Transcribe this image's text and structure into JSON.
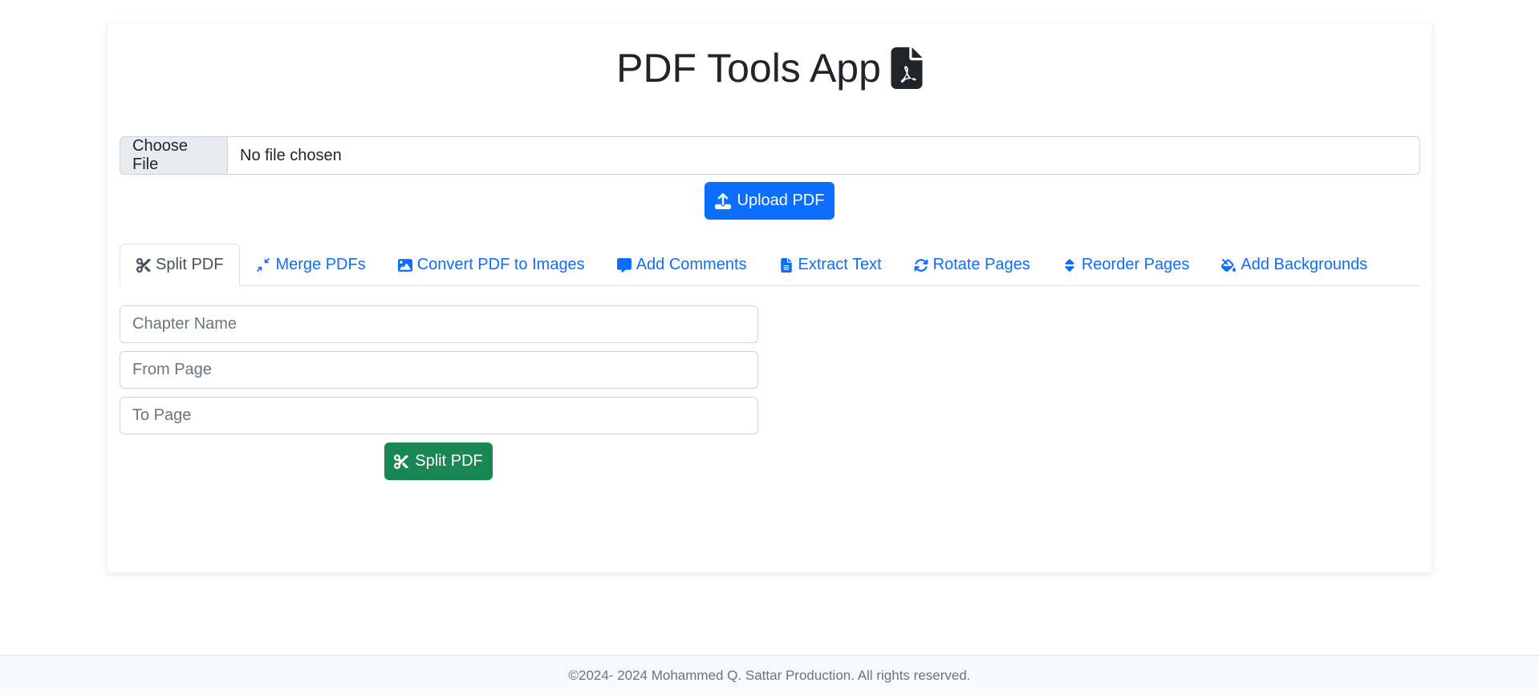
{
  "app": {
    "title": "PDF Tools App"
  },
  "upload": {
    "choose_file_label": "Choose File",
    "file_status": "No file chosen",
    "upload_button_label": "Upload PDF"
  },
  "tabs": [
    {
      "label": "Split PDF",
      "icon": "scissors-icon",
      "active": true
    },
    {
      "label": "Merge PDFs",
      "icon": "compress-icon",
      "active": false
    },
    {
      "label": "Convert PDF to Images",
      "icon": "image-icon",
      "active": false
    },
    {
      "label": "Add Comments",
      "icon": "comment-icon",
      "active": false
    },
    {
      "label": "Extract Text",
      "icon": "file-text-icon",
      "active": false
    },
    {
      "label": "Rotate Pages",
      "icon": "rotate-icon",
      "active": false
    },
    {
      "label": "Reorder Pages",
      "icon": "sort-icon",
      "active": false
    },
    {
      "label": "Add Backgrounds",
      "icon": "paint-bucket-icon",
      "active": false
    }
  ],
  "split_form": {
    "chapter_name_placeholder": "Chapter Name",
    "from_page_placeholder": "From Page",
    "to_page_placeholder": "To Page",
    "submit_label": "Split PDF"
  },
  "footer": {
    "text": "©2024- 2024 Mohammed Q. Sattar Production. All rights reserved."
  },
  "colors": {
    "primary": "#0d6efd",
    "success": "#198754",
    "text": "#212529",
    "muted": "#6c757d"
  }
}
